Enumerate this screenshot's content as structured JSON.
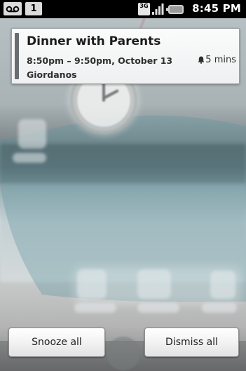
{
  "status_bar": {
    "voicemail_icon": "voicemail-icon",
    "calendar_badge": "1",
    "network_type": "3G",
    "time": "8:45 PM"
  },
  "notification": {
    "title": "Dinner with Parents",
    "time_range": "8:50pm – 9:50pm, October 13",
    "reminder": "5 mins",
    "reminder_icon": "bell-icon",
    "location": "Giordanos"
  },
  "actions": {
    "snooze_label": "Snooze all",
    "dismiss_label": "Dismiss all"
  },
  "colors": {
    "status_bar_bg": "#000000",
    "card_accent": "#6a6d6f"
  }
}
